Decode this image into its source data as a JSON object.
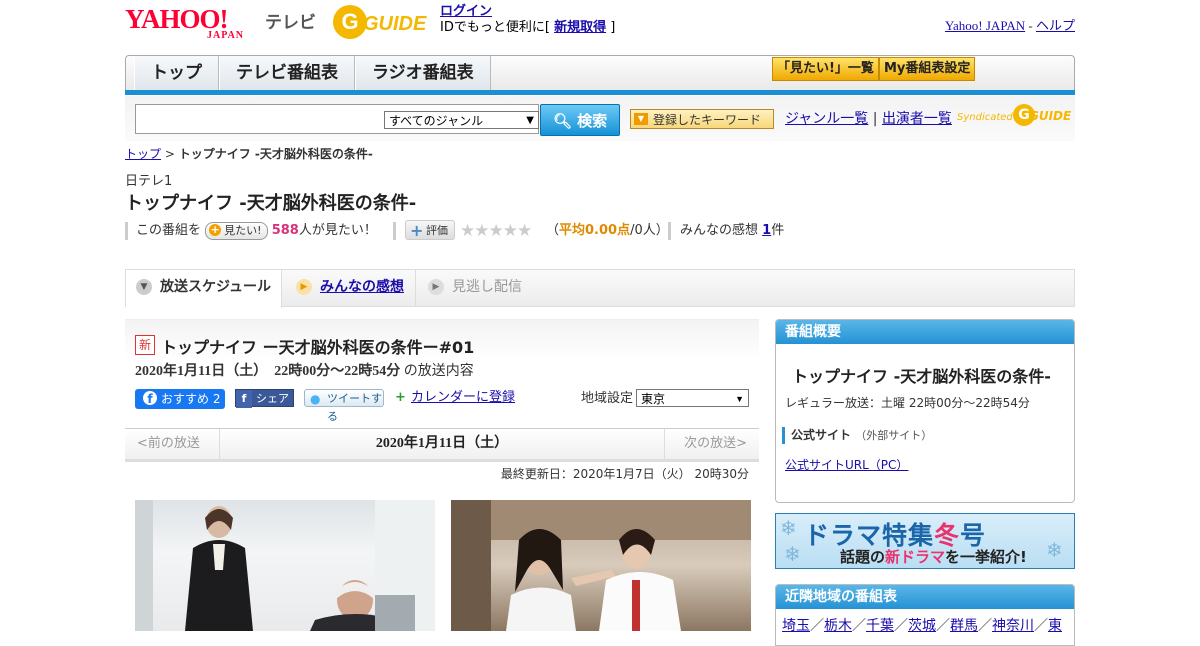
{
  "header": {
    "yahoo_logo": "YAHOO!",
    "yahoo_logo_sub": "JAPAN",
    "tv_label": "テレビ",
    "gguide_logo": "GUIDE",
    "login_link": "ログイン",
    "login_text_prefix": "IDでもっと便利に[",
    "signup_link": "新規取得",
    "login_text_suffix": "]",
    "yahoo_japan_link": "Yahoo! JAPAN",
    "separator": "-",
    "help_link": "ヘルプ"
  },
  "nav": {
    "tabs": [
      "トップ",
      "テレビ番組表",
      "ラジオ番組表"
    ],
    "mitai_list": "「見たい!」一覧",
    "my_schedule": "My番組表設定"
  },
  "search": {
    "genre_selected": "すべてのジャンル",
    "search_button": "検索",
    "keyword_button": "登録したキーワード",
    "genre_list_link": "ジャンル一覧",
    "divider": "|",
    "cast_list_link": "出演者一覧",
    "syndicated": "Syndicated",
    "syndicated_logo": "GUIDE"
  },
  "breadcrumb": {
    "home": "トップ",
    "sep": ">",
    "current": "トップナイフ -天才脳外科医の条件-"
  },
  "program": {
    "channel": "日テレ1",
    "title": "トップナイフ -天才脳外科医の条件-",
    "mitai_prefix": "この番組を",
    "mitai_button": "見たい!",
    "mitai_count": "588",
    "mitai_suffix": "人が見たい！",
    "hyoka_button": "評価",
    "stars": "★★★★★",
    "avg_open": "（",
    "avg_label": "平均0.00点",
    "avg_people": "/0人）",
    "kanso_prefix": "みんなの感想",
    "kanso_count": "1",
    "kanso_suffix": "件"
  },
  "tabs": {
    "schedule": "放送スケジュール",
    "kanso": "みんなの感想",
    "minogashi": "見逃し配信"
  },
  "episode": {
    "new_badge": "新",
    "title": "トップナイフ ー天才脳外科医の条件ー#01",
    "date_time": "2020年1月11日（土）　22時00分～22時54分",
    "date_suffix": "の放送内容",
    "fb_recommend": "おすすめ 2",
    "fb_share": "シェア",
    "tweet": "ツイートする",
    "calendar": "カレンダーに登録",
    "region_label": "地域設定",
    "region_value": "東京",
    "prev": "<前の放送",
    "current_date": "2020年1月11日（土）",
    "next": "次の放送>",
    "updated": "最終更新日：2020年1月7日（火） 20時30分"
  },
  "sidebar": {
    "overview_title": "番組概要",
    "program_title": "トップナイフ -天才脳外科医の条件-",
    "regular": "レギュラー放送：土曜 22時00分～22時54分",
    "official_label": "公式サイト",
    "official_note": "（外部サイト）",
    "official_link": "公式サイトURL（PC）",
    "banner_main_a": "ドラマ特集",
    "banner_main_b": "冬",
    "banner_main_c": "号",
    "banner_sub_a": "話題の",
    "banner_sub_b": "新ドラマ",
    "banner_sub_c": "を一挙紹介!",
    "near_title": "近隣地域の番組表",
    "near_links": [
      "埼玉",
      "栃木",
      "千葉",
      "茨城",
      "群馬",
      "神奈川",
      "東"
    ]
  },
  "colors": {
    "accent_blue": "#1a8fd4",
    "brand_red": "#ff0033",
    "gguide_yellow": "#f5b800",
    "mitai_pink": "#d6337a"
  }
}
